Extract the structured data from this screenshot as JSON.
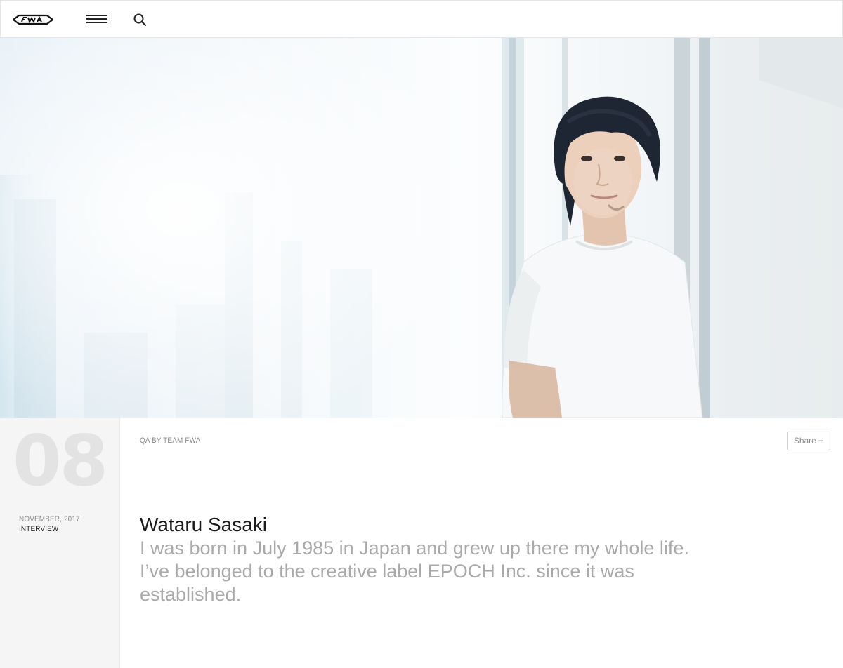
{
  "header": {
    "logo_text": "FWA",
    "menu_icon": "hamburger-menu-icon",
    "search_icon": "search-icon"
  },
  "hero": {
    "image_subject": "portrait photo"
  },
  "article": {
    "issue_number": "08",
    "date": "NOVEMBER, 2017",
    "category": "INTERVIEW",
    "byline": "QA BY TEAM FWA",
    "share_label": "Share +",
    "name": "Wataru Sasaki",
    "bio": "I was born in July 1985 in Japan and grew up there my whole life. I’ve belonged to the creative label EPOCH Inc. since it was established."
  }
}
